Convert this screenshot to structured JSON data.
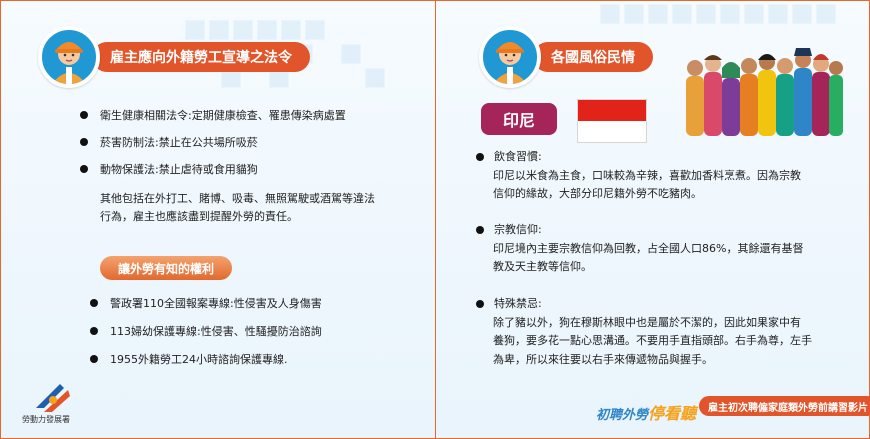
{
  "left": {
    "header_title": "雇主應向外籍勞工宣導之法令",
    "laws": [
      "衛生健康相關法令:定期健康檢查、罹患傳染病處置",
      "菸害防制法:禁止在公共場所吸菸",
      "動物保護法:禁止虐待或食用貓狗"
    ],
    "note_line1": "其他包括在外打工、賭博、吸毒、無照駕駛或酒駕等違法",
    "note_line2": "行為，雇主也應該盡到提醒外勞的責任。",
    "rights_title": "讓外勞有知的權利",
    "rights": [
      "警政署110全國報案專線:性侵害及人身傷害",
      "113婦幼保護專線:性侵害、性騷擾防治諮詢",
      "1955外籍勞工24小時諮詢保護專線."
    ],
    "logo_text": "勞動力發展署"
  },
  "right": {
    "header_title": "各國風俗民情",
    "country_label": "印尼",
    "sections": [
      {
        "title": "飲食習慣:",
        "line1": "印尼以米食為主食，口味較為辛辣，喜歡加香料烹煮。因為宗教",
        "line2": "信仰的緣故，大部分印尼籍外勞不吃豬肉。",
        "line3": ""
      },
      {
        "title": "宗教信仰:",
        "line1": "印尼境內主要宗教信仰為回教，占全國人口86%，其餘還有基督",
        "line2": "教及天主教等信仰。",
        "line3": ""
      },
      {
        "title": "特殊禁忌:",
        "line1": "除了豬以外，狗在穆斯林眼中也是屬於不潔的，因此如果家中有",
        "line2": "養狗，要多花一點心思溝通。不要用手直指頭部。右手為尊，左手",
        "line3": "為卑，所以來往要以右手來傳遞物品與握手。"
      }
    ],
    "footer_brand_a": "初聘外勞",
    "footer_brand_b": "停看聽",
    "footer_pill": "雇主初次聘僱家庭類外勞前講習影片"
  },
  "colors": {
    "accent": "#e2552a",
    "indonesia_pill": "#a5255a",
    "flag_red": "#e2231a",
    "avatar_blue": "#1f98d3"
  },
  "icons": [
    "worker-avatar-icon",
    "worker-avatar-icon",
    "indonesia-flag",
    "people-illustration",
    "agency-logo"
  ]
}
